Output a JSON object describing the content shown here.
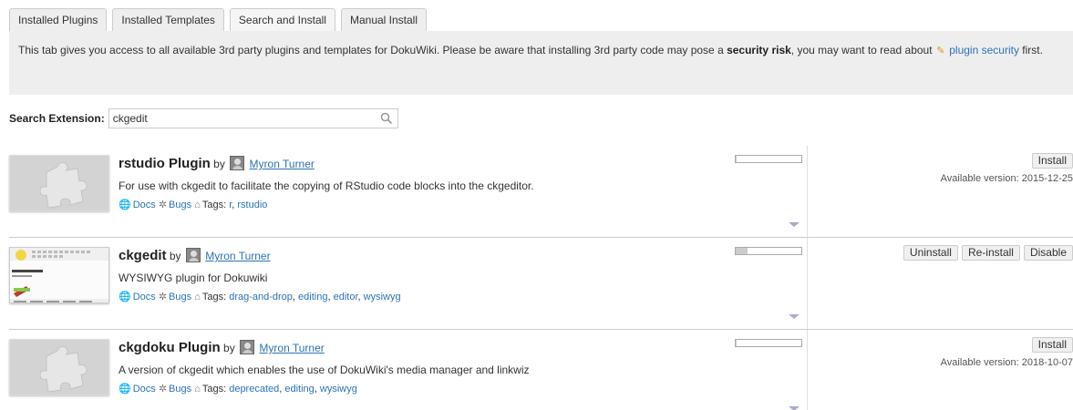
{
  "tabs": [
    {
      "label": "Installed Plugins",
      "active": false
    },
    {
      "label": "Installed Templates",
      "active": false
    },
    {
      "label": "Search and Install",
      "active": true
    },
    {
      "label": "Manual Install",
      "active": false
    }
  ],
  "info": {
    "text_before": "This tab gives you access to all available 3rd party plugins and templates for DokuWiki. Please be aware that installing 3rd party code may pose a ",
    "bold": "security risk",
    "text_middle": ", you may want to read about ",
    "link": "plugin security",
    "text_after": " first."
  },
  "search": {
    "label": "Search Extension:",
    "value": "ckgedit"
  },
  "extensions": [
    {
      "name": "rstudio Plugin",
      "by": "by",
      "author": "Myron Turner",
      "description": "For use with ckgedit to facilitate the copying of RStudio code blocks into the ckgeditor.",
      "docs": "Docs",
      "bugs": "Bugs",
      "tags_label": "Tags:",
      "tags": [
        "r",
        "rstudio"
      ],
      "popularity": 0.02,
      "buttons": [
        "Install"
      ],
      "available_version": "Available version: 2015-12-25",
      "thumb": "puzzle"
    },
    {
      "name": "ckgedit",
      "by": "by",
      "author": "Myron Turner",
      "description": "WYSIWYG plugin for Dokuwiki",
      "docs": "Docs",
      "bugs": "Bugs",
      "tags_label": "Tags:",
      "tags": [
        "drag-and-drop",
        "editing",
        "editor",
        "wysiwyg"
      ],
      "popularity": 0.18,
      "buttons": [
        "Uninstall",
        "Re-install",
        "Disable"
      ],
      "available_version": "",
      "thumb": "screenshot"
    },
    {
      "name": "ckgdoku Plugin",
      "by": "by",
      "author": "Myron Turner",
      "description": "A version of ckgedit which enables the use of DokuWiki's media manager and linkwiz",
      "docs": "Docs",
      "bugs": "Bugs",
      "tags_label": "Tags:",
      "tags": [
        "deprecated",
        "editing",
        "wysiwyg"
      ],
      "popularity": 0.02,
      "buttons": [
        "Install"
      ],
      "available_version": "Available version: 2018-10-07",
      "thumb": "puzzle"
    }
  ]
}
